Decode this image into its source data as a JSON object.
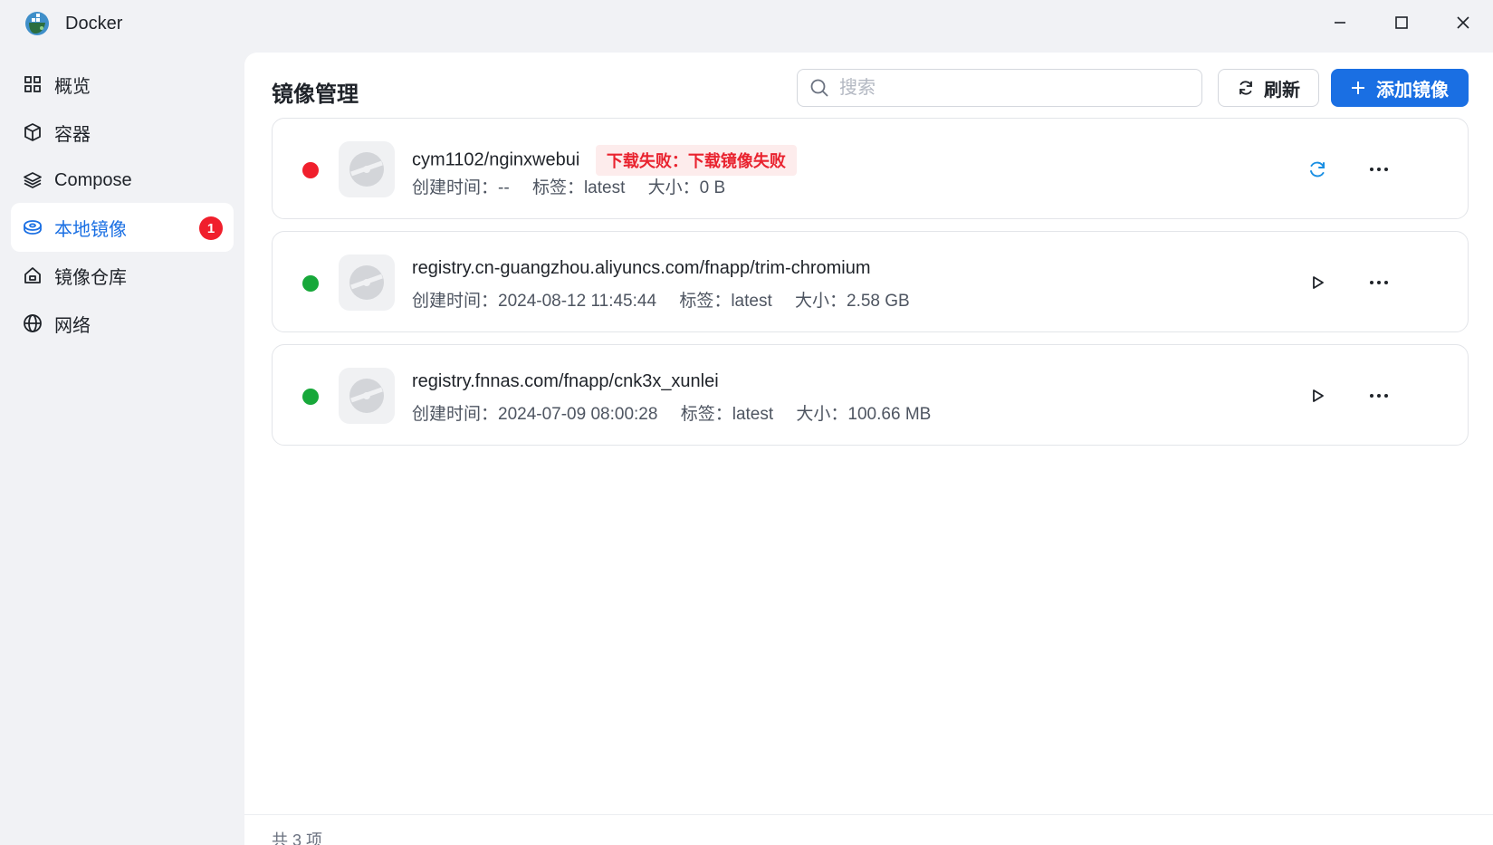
{
  "window": {
    "title": "Docker",
    "controls": [
      "minimize",
      "maximize",
      "close"
    ]
  },
  "colors": {
    "accent": "#1a6fe3",
    "error": "#f01f2c",
    "success": "#17a83a",
    "background": "#f1f2f5"
  },
  "sidebar": {
    "items": [
      {
        "label": "概览",
        "icon": "grid-icon",
        "active": false
      },
      {
        "label": "容器",
        "icon": "box-icon",
        "active": false
      },
      {
        "label": "Compose",
        "icon": "layers-icon",
        "active": false
      },
      {
        "label": "本地镜像",
        "icon": "disc-icon",
        "active": true,
        "badge": "1"
      },
      {
        "label": "镜像仓库",
        "icon": "home-icon",
        "active": false
      },
      {
        "label": "网络",
        "icon": "globe-icon",
        "active": false
      }
    ]
  },
  "main": {
    "title": "镜像管理",
    "search": {
      "placeholder": "搜索",
      "value": ""
    },
    "refresh_label": "刷新",
    "add_label": "添加镜像",
    "images": [
      {
        "name": "cym1102/nginxwebui",
        "status": "error",
        "error_text": "下载失败：下载镜像失败",
        "created": "创建时间：--",
        "tag": "标签：latest",
        "size": "大小：0 B",
        "action_icon": "retry-icon"
      },
      {
        "name": "registry.cn-guangzhou.aliyuncs.com/fnapp/trim-chromium",
        "status": "ok",
        "created": "创建时间：2024-08-12 11:45:44",
        "tag": "标签：latest",
        "size": "大小：2.58 GB",
        "action_icon": "play-icon"
      },
      {
        "name": "registry.fnnas.com/fnapp/cnk3x_xunlei",
        "status": "ok",
        "created": "创建时间：2024-07-09 08:00:28",
        "tag": "标签：latest",
        "size": "大小：100.66 MB",
        "action_icon": "play-icon"
      }
    ],
    "footer": {
      "count_text": "共 3 项"
    }
  }
}
